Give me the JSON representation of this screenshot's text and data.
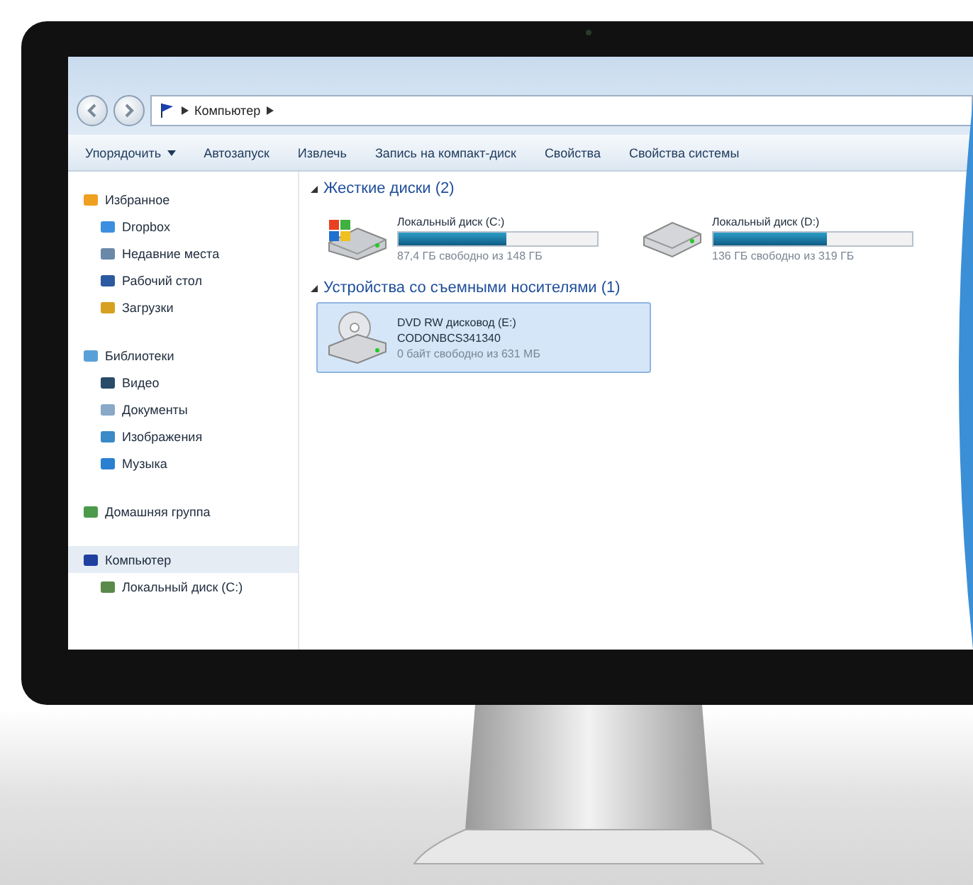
{
  "address": {
    "crumbs": [
      "Компьютер"
    ]
  },
  "toolbar": {
    "items": [
      {
        "label": "Упорядочить",
        "kind": "menu"
      },
      {
        "label": "Автозапуск",
        "kind": "button"
      },
      {
        "label": "Извлечь",
        "kind": "button"
      },
      {
        "label": "Запись на компакт-диск",
        "kind": "button"
      },
      {
        "label": "Свойства",
        "kind": "button"
      },
      {
        "label": "Свойства системы",
        "kind": "button"
      }
    ]
  },
  "sidebar": {
    "groups": [
      {
        "label": "Избранное",
        "selected": false,
        "children": [
          {
            "label": "Dropbox",
            "selected": false
          },
          {
            "label": "Недавние места",
            "selected": false
          },
          {
            "label": "Рабочий стол",
            "selected": false
          },
          {
            "label": "Загрузки",
            "selected": false
          }
        ]
      },
      {
        "label": "Библиотеки",
        "selected": false,
        "children": [
          {
            "label": "Видео",
            "selected": false
          },
          {
            "label": "Документы",
            "selected": false
          },
          {
            "label": "Изображения",
            "selected": false
          },
          {
            "label": "Музыка",
            "selected": false
          }
        ]
      },
      {
        "label": "Домашняя группа",
        "selected": false
      },
      {
        "label": "Компьютер",
        "selected": true,
        "children": [
          {
            "label": "Локальный диск (C:)",
            "selected": false
          }
        ]
      }
    ]
  },
  "sections": [
    {
      "title": "Жесткие диски (2)",
      "drives": [
        {
          "kind": "system",
          "name": "Локальный диск (C:)",
          "free": "87,4 ГБ свободно из 148 ГБ",
          "level": 0.54,
          "selected": false
        },
        {
          "kind": "hdd",
          "name": "Локальный диск (D:)",
          "free": "136 ГБ свободно из 319 ГБ",
          "level": 0.57,
          "selected": false
        }
      ]
    },
    {
      "title": "Устройства со съемными носителями (1)",
      "drives": [
        {
          "kind": "dvd",
          "name": "DVD RW дисковод (E:)",
          "label": "CODONBCS341340",
          "free": "0 байт свободно из 631 МБ",
          "selected": true
        }
      ]
    }
  ]
}
